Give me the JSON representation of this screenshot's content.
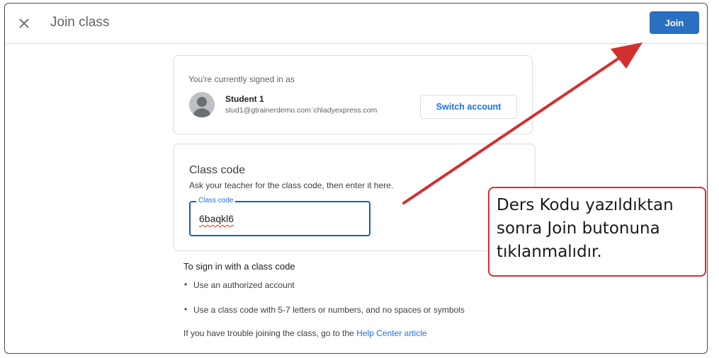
{
  "header": {
    "close_icon": "close-icon",
    "title": "Join class",
    "join_label": "Join"
  },
  "account": {
    "signed_in_label": "You're currently signed in as",
    "avatar_icon": "person-avatar-icon",
    "name": "Student 1",
    "email": "stud1@gtrainerdemo.comʾchladyexpress.com",
    "switch_label": "Switch account"
  },
  "class_code": {
    "title": "Class code",
    "help": "Ask your teacher for the class code, then enter it here.",
    "field_label": "Class code",
    "field_value": "6baqkl6"
  },
  "instructions": {
    "title": "To sign in with a class code",
    "items": [
      "Use an authorized account",
      "Use a class code with 5-7 letters or numbers, and no spaces or symbols"
    ],
    "trouble_prefix": "If you have trouble joining the class, go to the ",
    "help_link": "Help Center article"
  },
  "annotation": {
    "text": "Ders Kodu yazıldıktan sonra Join butonuna tıklanmalıdır.",
    "arrow_color": "#d32f2f"
  },
  "colors": {
    "accent": "#1a73e8",
    "join_button": "#2a6fc0",
    "annotation": "#d32f2f"
  }
}
